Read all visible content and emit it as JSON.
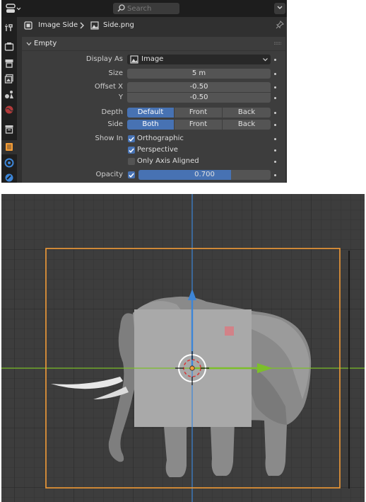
{
  "topbar": {
    "search_placeholder": "Search"
  },
  "breadcrumb": {
    "object": "Image Side",
    "data": "Side.png"
  },
  "panel": {
    "title": "Empty",
    "display_as": {
      "label": "Display As",
      "value": "Image"
    },
    "size": {
      "label": "Size",
      "value": "5 m"
    },
    "offset_x": {
      "label": "Offset X",
      "value": "-0.50"
    },
    "offset_y": {
      "label": "Y",
      "value": "-0.50"
    },
    "depth": {
      "label": "Depth",
      "options": [
        "Default",
        "Front",
        "Back"
      ],
      "selected": "Default"
    },
    "side": {
      "label": "Side",
      "options": [
        "Both",
        "Front",
        "Back"
      ],
      "selected": "Both"
    },
    "show_in": {
      "label": "Show In",
      "orthographic": {
        "label": "Orthographic",
        "checked": true
      },
      "perspective": {
        "label": "Perspective",
        "checked": true
      },
      "only_axis_aligned": {
        "label": "Only Axis Aligned",
        "checked": false
      }
    },
    "opacity": {
      "label": "Opacity",
      "value": "0.700",
      "fraction": 0.7,
      "enabled": true
    }
  },
  "colors": {
    "accent": "#4772b3",
    "selection_outline": "#f39c37",
    "axis_x": "#7cbf2a",
    "axis_z": "#3d86d8"
  },
  "icons": [
    "editor-type-icon",
    "search-icon",
    "menu-chevron-icon",
    "tool-icon",
    "render-icon",
    "output-icon",
    "view-layer-icon",
    "scene-icon",
    "world-icon",
    "collection-icon",
    "object-icon",
    "physics-icon",
    "constraints-icon",
    "empty-object-icon",
    "image-icon",
    "pin-icon",
    "expand-arrow-icon",
    "drag-grip-icon",
    "checkmark-icon"
  ]
}
